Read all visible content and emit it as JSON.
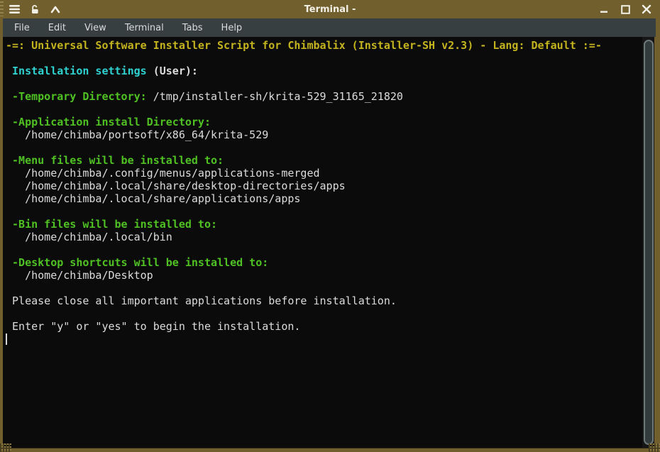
{
  "window": {
    "title": "Terminal -"
  },
  "titlebar": {
    "icons": [
      "window-menu",
      "unlock",
      "up-chevron"
    ],
    "buttons": [
      "minimize",
      "maximize",
      "close"
    ]
  },
  "menu": {
    "items": [
      "File",
      "Edit",
      "View",
      "Terminal",
      "Tabs",
      "Help"
    ]
  },
  "colors": {
    "yellow": "#c3b41e",
    "cyan": "#2fd1d1",
    "green": "#4fc122",
    "white": "#dcdcdc",
    "titlebar": "#715f2e",
    "menubar": "#383f40",
    "terminal_bg": "#0b0b0b"
  },
  "terminal": {
    "lines": [
      {
        "segments": [
          {
            "color": "yellow",
            "bold": true,
            "text": "-=: Universal Software Installer Script for Chimbalix (Installer-SH v2.3) - Lang: Default :=-"
          }
        ]
      },
      {
        "segments": []
      },
      {
        "segments": [
          {
            "color": "cyan",
            "bold": true,
            "text": " Installation settings "
          },
          {
            "color": "white",
            "bold": true,
            "text": "(User):"
          }
        ]
      },
      {
        "segments": []
      },
      {
        "segments": [
          {
            "color": "green",
            "bold": true,
            "text": " -Temporary Directory: "
          },
          {
            "color": "white",
            "bold": false,
            "text": "/tmp/installer-sh/krita-529_31165_21820"
          }
        ]
      },
      {
        "segments": []
      },
      {
        "segments": [
          {
            "color": "green",
            "bold": true,
            "text": " -Application install Directory:"
          }
        ]
      },
      {
        "segments": [
          {
            "color": "white",
            "bold": false,
            "text": "   /home/chimba/portsoft/x86_64/krita-529"
          }
        ]
      },
      {
        "segments": []
      },
      {
        "segments": [
          {
            "color": "green",
            "bold": true,
            "text": " -Menu files will be installed to:"
          }
        ]
      },
      {
        "segments": [
          {
            "color": "white",
            "bold": false,
            "text": "   /home/chimba/.config/menus/applications-merged"
          }
        ]
      },
      {
        "segments": [
          {
            "color": "white",
            "bold": false,
            "text": "   /home/chimba/.local/share/desktop-directories/apps"
          }
        ]
      },
      {
        "segments": [
          {
            "color": "white",
            "bold": false,
            "text": "   /home/chimba/.local/share/applications/apps"
          }
        ]
      },
      {
        "segments": []
      },
      {
        "segments": [
          {
            "color": "green",
            "bold": true,
            "text": " -Bin files will be installed to:"
          }
        ]
      },
      {
        "segments": [
          {
            "color": "white",
            "bold": false,
            "text": "   /home/chimba/.local/bin"
          }
        ]
      },
      {
        "segments": []
      },
      {
        "segments": [
          {
            "color": "green",
            "bold": true,
            "text": " -Desktop shortcuts will be installed to:"
          }
        ]
      },
      {
        "segments": [
          {
            "color": "white",
            "bold": false,
            "text": "   /home/chimba/Desktop"
          }
        ]
      },
      {
        "segments": []
      },
      {
        "segments": [
          {
            "color": "white",
            "bold": false,
            "text": " Please close all important applications before installation."
          }
        ]
      },
      {
        "segments": []
      },
      {
        "segments": [
          {
            "color": "white",
            "bold": false,
            "text": " Enter \"y\" or \"yes\" to begin the installation."
          }
        ]
      },
      {
        "segments": [],
        "cursor": true
      }
    ]
  }
}
